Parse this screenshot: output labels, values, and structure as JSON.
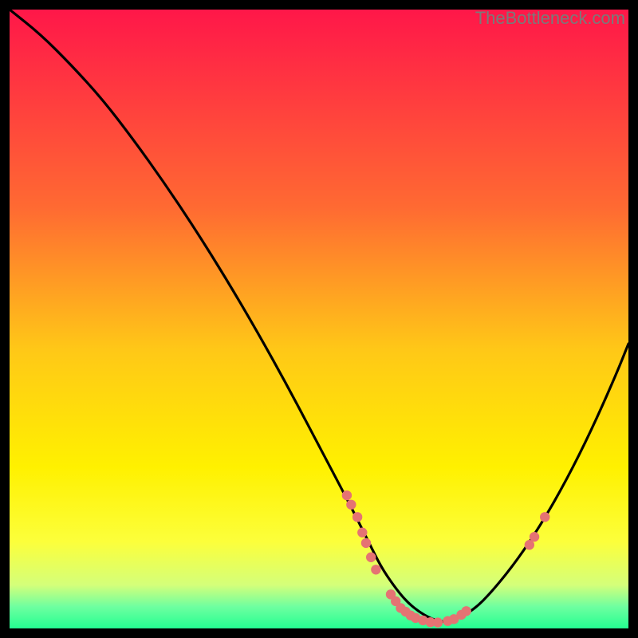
{
  "watermark": "TheBottleneck.com",
  "chart_data": {
    "type": "line",
    "title": "",
    "xlabel": "",
    "ylabel": "",
    "xlim": [
      0,
      100
    ],
    "ylim": [
      0,
      100
    ],
    "curve": {
      "x": [
        0,
        5,
        10,
        15,
        20,
        25,
        30,
        35,
        40,
        45,
        50,
        55,
        58,
        60,
        62,
        64,
        66,
        68,
        70,
        72,
        75,
        78,
        82,
        86,
        90,
        94,
        98,
        100
      ],
      "y": [
        100,
        96,
        91,
        85.5,
        79,
        72,
        64.5,
        56.5,
        48,
        39,
        29.5,
        20,
        14,
        10,
        7,
        4.5,
        2.8,
        1.6,
        1.0,
        1.4,
        3,
        6,
        11,
        17,
        24,
        32,
        41,
        46
      ]
    },
    "dots": [
      {
        "x": 54.5,
        "y": 21.5
      },
      {
        "x": 55.2,
        "y": 20
      },
      {
        "x": 56.2,
        "y": 18
      },
      {
        "x": 57.0,
        "y": 15.5
      },
      {
        "x": 57.6,
        "y": 13.8
      },
      {
        "x": 58.4,
        "y": 11.5
      },
      {
        "x": 59.2,
        "y": 9.5
      },
      {
        "x": 61.6,
        "y": 5.5
      },
      {
        "x": 62.4,
        "y": 4.4
      },
      {
        "x": 63.2,
        "y": 3.3
      },
      {
        "x": 64.0,
        "y": 2.7
      },
      {
        "x": 64.8,
        "y": 2.1
      },
      {
        "x": 65.6,
        "y": 1.7
      },
      {
        "x": 66.8,
        "y": 1.3
      },
      {
        "x": 68.0,
        "y": 1.0
      },
      {
        "x": 69.2,
        "y": 0.95
      },
      {
        "x": 70.8,
        "y": 1.2
      },
      {
        "x": 71.8,
        "y": 1.5
      },
      {
        "x": 73.0,
        "y": 2.2
      },
      {
        "x": 73.8,
        "y": 2.8
      },
      {
        "x": 84.0,
        "y": 13.5
      },
      {
        "x": 84.8,
        "y": 14.8
      },
      {
        "x": 86.5,
        "y": 18.0
      }
    ],
    "gradient_stops": [
      {
        "offset": 0,
        "color": "#ff1749"
      },
      {
        "offset": 0.32,
        "color": "#ff6a32"
      },
      {
        "offset": 0.55,
        "color": "#ffc817"
      },
      {
        "offset": 0.74,
        "color": "#fff100"
      },
      {
        "offset": 0.86,
        "color": "#fcff3b"
      },
      {
        "offset": 0.93,
        "color": "#d4ff7a"
      },
      {
        "offset": 0.965,
        "color": "#6effa0"
      },
      {
        "offset": 1.0,
        "color": "#24ff91"
      }
    ],
    "curve_color": "#000000",
    "dot_color": "#e57373"
  }
}
